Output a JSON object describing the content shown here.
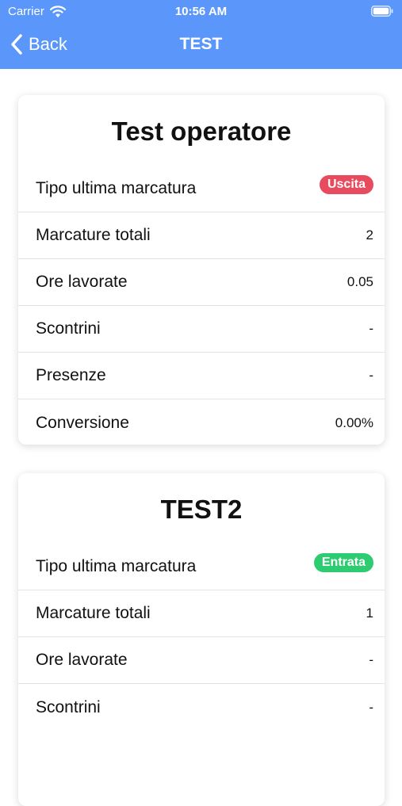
{
  "status_bar": {
    "carrier": "Carrier",
    "time": "10:56 AM",
    "wifi_icon": "wifi-icon",
    "battery_icon": "battery-icon"
  },
  "nav": {
    "back_label": "Back",
    "title": "TEST",
    "back_icon": "chevron-left-icon"
  },
  "colors": {
    "header": "#5b97fb",
    "badge_uscita": "#e84b5e",
    "badge_entrata": "#2ecc71"
  },
  "cards": [
    {
      "title": "Test operatore",
      "rows": [
        {
          "label": "Tipo ultima marcatura",
          "value": "Uscita"
        },
        {
          "label": "Marcature totali",
          "value": "2"
        },
        {
          "label": "Ore lavorate",
          "value": "0.05"
        },
        {
          "label": "Scontrini",
          "value": "-"
        },
        {
          "label": "Presenze",
          "value": "-"
        },
        {
          "label": "Conversione",
          "value": "0.00%"
        }
      ]
    },
    {
      "title": "TEST2",
      "rows": [
        {
          "label": "Tipo ultima marcatura",
          "value": "Entrata"
        },
        {
          "label": "Marcature totali",
          "value": "1"
        },
        {
          "label": "Ore lavorate",
          "value": "-"
        },
        {
          "label": "Scontrini",
          "value": "-"
        }
      ]
    }
  ]
}
